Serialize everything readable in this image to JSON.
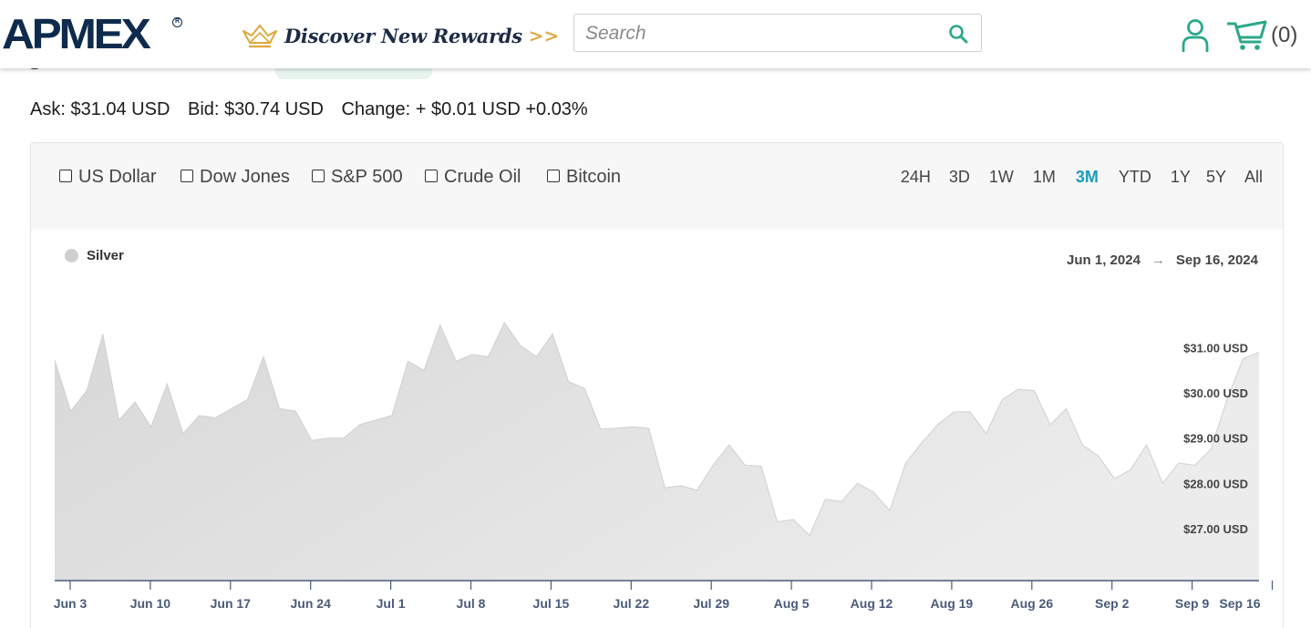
{
  "header": {
    "logo": "APMEX",
    "logo_mark": "R",
    "rewards_label": "Discover New Rewards",
    "rewards_arrows": ">>",
    "search_placeholder": "Search",
    "cart_count": "(0)",
    "icons": [
      "crown-icon",
      "search-icon",
      "user-icon",
      "cart-icon"
    ],
    "accent_color": "#2ba88a"
  },
  "quote": {
    "ask": "Ask: $31.04 USD",
    "bid": "Bid: $30.74 USD",
    "change": "Change: + $0.01 USD +0.03%"
  },
  "compare": [
    {
      "label": "US Dollar",
      "checked": false
    },
    {
      "label": "Dow Jones",
      "checked": false
    },
    {
      "label": "S&P 500",
      "checked": false
    },
    {
      "label": "Crude Oil",
      "checked": false
    },
    {
      "label": "Bitcoin",
      "checked": false
    }
  ],
  "ranges": {
    "items": [
      "24H",
      "3D",
      "1W",
      "1M",
      "3M",
      "YTD",
      "1Y",
      "5Y",
      "All"
    ],
    "active": "3M",
    "active_color": "#1a9bbf"
  },
  "legend": {
    "series": "Silver"
  },
  "date_range": {
    "from": "Jun 1, 2024",
    "arrow": "→",
    "to": "Sep 16, 2024"
  },
  "chart_data": {
    "type": "area",
    "series": [
      {
        "name": "Silver",
        "values": [
          30.72,
          29.6,
          30.05,
          31.3,
          29.4,
          29.8,
          29.25,
          30.2,
          29.1,
          29.5,
          29.45,
          29.65,
          29.85,
          30.8,
          29.65,
          29.6,
          28.95,
          29.0,
          29.0,
          29.3,
          29.4,
          29.5,
          30.7,
          30.5,
          31.5,
          30.7,
          30.85,
          30.8,
          31.55,
          31.05,
          30.8,
          31.3,
          30.25,
          30.1,
          29.2,
          29.22,
          29.25,
          29.22,
          27.9,
          27.95,
          27.85,
          28.4,
          28.85,
          28.4,
          28.38,
          27.15,
          27.2,
          26.85,
          27.65,
          27.6,
          28.0,
          27.8,
          27.4,
          28.45,
          28.9,
          29.3,
          29.58,
          29.58,
          29.1,
          29.85,
          30.08,
          30.05,
          29.3,
          29.65,
          28.85,
          28.6,
          28.1,
          28.3,
          28.85,
          28.0,
          28.45,
          28.4,
          28.75,
          29.85,
          30.75,
          30.9
        ]
      }
    ],
    "x_tick_labels": [
      "Jun 3",
      "Jun 10",
      "Jun 17",
      "Jun 24",
      "Jul 1",
      "Jul 8",
      "Jul 15",
      "Jul 22",
      "Jul 29",
      "Aug 5",
      "Aug 12",
      "Aug 19",
      "Aug 26",
      "Sep 2",
      "Sep 9",
      "Sep 16"
    ],
    "y_tick_labels": [
      "$27.00 USD",
      "$28.00 USD",
      "$29.00 USD",
      "$30.00 USD",
      "$31.00 USD"
    ],
    "y_ticks": [
      27,
      28,
      29,
      30,
      31
    ],
    "ylim": [
      25.85,
      32.5
    ],
    "grid": false,
    "legend_position": "top-left",
    "fill_color": "#dedede",
    "line_color": "#d0d0d0",
    "axis_color": "#4a5a7a"
  }
}
